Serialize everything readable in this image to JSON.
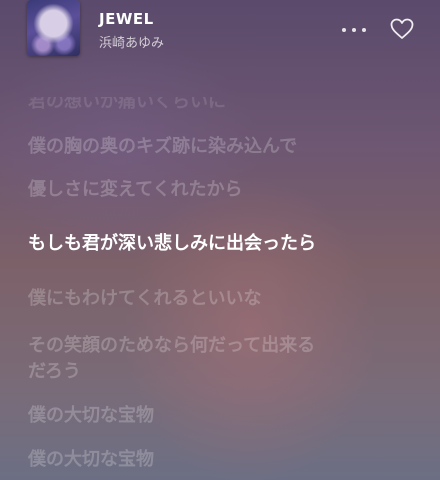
{
  "now_playing": {
    "title": "JEWEL",
    "artist": "浜崎あゆみ",
    "artwork_icon": "album-artwork",
    "more_icon": "ellipsis-icon",
    "favorite_icon": "heart-outline-icon"
  },
  "lyrics": {
    "lines": [
      "君の想いが痛いくらいに",
      "僕の胸の奥のキズ跡に染み込んで",
      "優しさに変えてくれたから",
      "もしも君が深い悲しみに出会ったら",
      "僕にもわけてくれるといいな",
      "その笑顔のためなら何だって出来る\nだろう",
      "僕の大切な宝物",
      "僕の大切な宝物"
    ],
    "active_index": 3
  }
}
